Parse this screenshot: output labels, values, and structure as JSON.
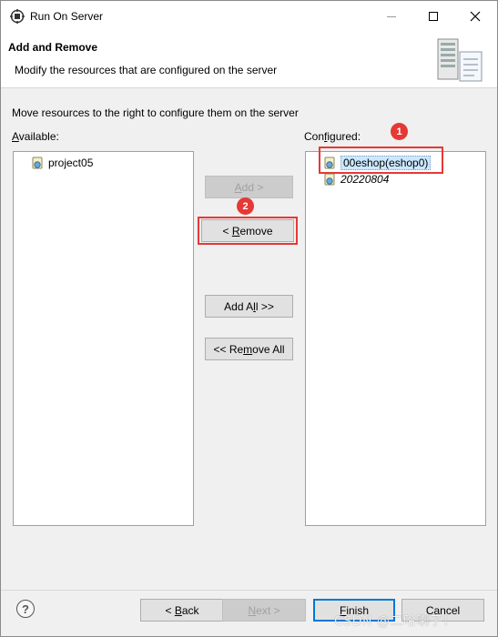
{
  "window": {
    "title": "Run On Server"
  },
  "header": {
    "title": "Add and Remove",
    "description": "Modify the resources that are configured on the server"
  },
  "instructions": "Move resources to the right to configure them on the server",
  "available": {
    "label_mnemonic": "A",
    "label_rest": "vailable:",
    "items": [
      {
        "label": "project05"
      }
    ]
  },
  "configured": {
    "label_pre": "Con",
    "label_mnemonic": "f",
    "label_rest": "igured:",
    "items": [
      {
        "label": "00eshop(eshop0)",
        "selected": true
      },
      {
        "label": "20220804",
        "italic": true
      }
    ]
  },
  "buttons": {
    "add": {
      "pre": "",
      "mn": "A",
      "post": "dd >"
    },
    "remove": {
      "pre": "< ",
      "mn": "R",
      "post": "emove"
    },
    "add_all": {
      "pre": "Add A",
      "mn": "l",
      "post": "l >>"
    },
    "remove_all": {
      "pre": "<< Re",
      "mn": "m",
      "post": "ove All"
    },
    "back": {
      "pre": "< ",
      "mn": "B",
      "post": "ack"
    },
    "next": {
      "pre": "",
      "mn": "N",
      "post": "ext >"
    },
    "finish": {
      "pre": "",
      "mn": "F",
      "post": "inish"
    },
    "cancel": {
      "pre": "Cancel",
      "mn": "",
      "post": ""
    }
  },
  "annotations": [
    "1",
    "2"
  ],
  "watermark": "CSDN @二哈喇子！",
  "colors": {
    "highlight": "#e53935",
    "selection": "#cce8ff",
    "default_button_border": "#0078d7"
  },
  "icons": {
    "app": "run-on-server-icon",
    "header": "server-wizard-banner-icon",
    "module": "web-module-icon",
    "help": "help-icon"
  }
}
